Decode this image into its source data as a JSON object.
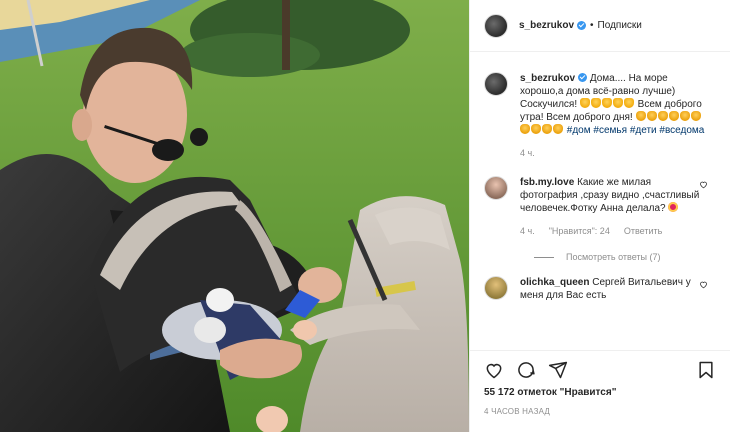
{
  "post": {
    "username": "s_bezrukov",
    "separator": "•",
    "follow_label": "Подписки",
    "likes_count": "55 172",
    "likes_suffix": "отметок \"Нравится\"",
    "timestamp": "4 ЧАСОВ НАЗАД"
  },
  "caption": {
    "username": "s_bezrukov",
    "text_1": "Дома.... На море хорошо,а дома всё-равно лучше) Соскучился!",
    "text_2": "Всем доброго утра! Всем доброго дня!",
    "tags": [
      "#дом",
      "#семья",
      "#дети",
      "#вседома"
    ],
    "age": "4 ч."
  },
  "comments": [
    {
      "username": "fsb.my.love",
      "text": "Какие же милая фотография ,сразу видно ,счастливый человечек.Фотку Анна делала?",
      "age": "4 ч.",
      "likes_label": "\"Нравится\": 24",
      "reply_label": "Ответить",
      "view_replies": "Посмотреть ответы (7)"
    },
    {
      "username": "olichka_queen",
      "text": "Сергей Витальевич у меня для Вас есть"
    }
  ],
  "icons": {
    "like": "heart-icon",
    "comment": "comment-icon",
    "share": "share-icon",
    "save": "bookmark-icon",
    "verified": "verified-badge-icon"
  },
  "colors": {
    "link": "#00376b",
    "verified": "#3897f0",
    "muted": "#8e8e8e",
    "text": "#262626"
  }
}
